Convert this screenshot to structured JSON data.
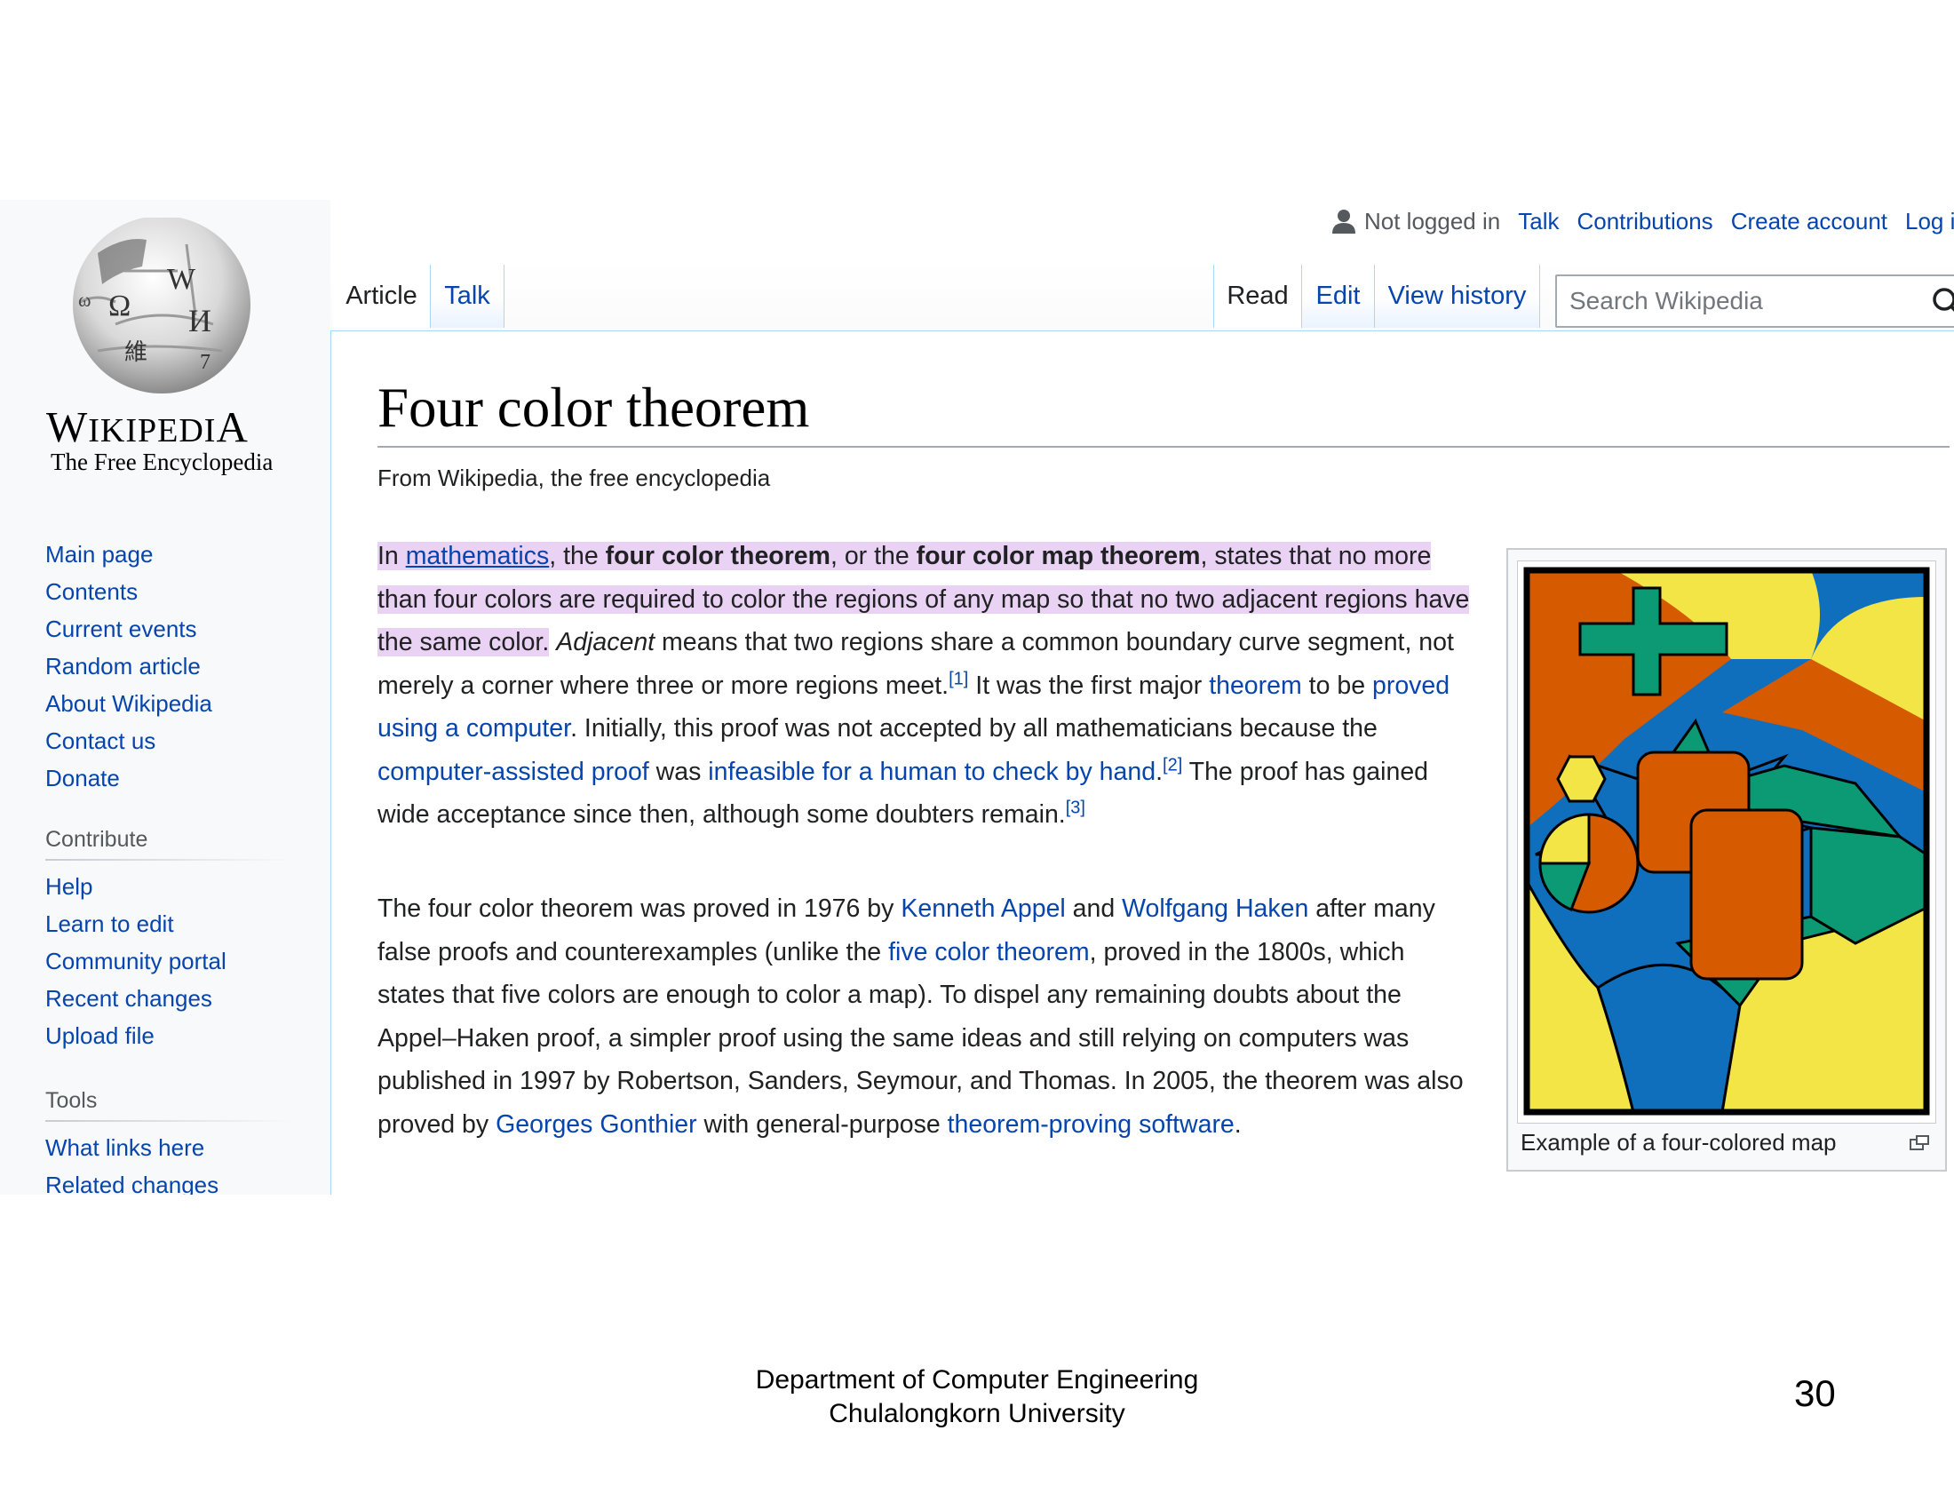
{
  "personal": {
    "not_logged_in": "Not logged in",
    "links": [
      "Talk",
      "Contributions",
      "Create account",
      "Log in"
    ]
  },
  "logo": {
    "wordmark": "Wikipedia",
    "tagline": "The Free Encyclopedia"
  },
  "sidebar": {
    "main": [
      "Main page",
      "Contents",
      "Current events",
      "Random article",
      "About Wikipedia",
      "Contact us",
      "Donate"
    ],
    "contribute_heading": "Contribute",
    "contribute": [
      "Help",
      "Learn to edit",
      "Community portal",
      "Recent changes",
      "Upload file"
    ],
    "tools_heading": "Tools",
    "tools": [
      "What links here",
      "Related changes"
    ]
  },
  "tabs": {
    "article": "Article",
    "talk": "Talk",
    "read": "Read",
    "edit": "Edit",
    "view_history": "View history"
  },
  "search": {
    "placeholder": "Search Wikipedia"
  },
  "article": {
    "title": "Four color theorem",
    "from": "From Wikipedia, the free encyclopedia",
    "p1": {
      "in": "In ",
      "mathematics": "mathematics",
      "comma_the": ", the ",
      "fct": "four color theorem",
      "or_the": ", or the ",
      "fcmt": "four color map theorem",
      "rest_hl": ", states that no more than four colors are required to color the regions of any map so that no two adjacent regions have the same color.",
      "adjacent": "Adjacent",
      "means": " means that two regions share a common boundary curve segment, not merely a corner where three or more regions meet.",
      "ref1": "[1]",
      "it_was": " It was the first major ",
      "theorem": "theorem",
      "to_be": " to be ",
      "proved_computer": "proved using a computer",
      "initially": ". Initially, this proof was not accepted by all mathematicians because the ",
      "cap": "computer-assisted proof",
      "was": " was ",
      "infeasible": "infeasible for a human to check by hand",
      "dot": ".",
      "ref2": "[2]",
      "gained": " The proof has gained wide acceptance since then, although some doubters remain.",
      "ref3": "[3]"
    },
    "p2": {
      "a": "The four color theorem was proved in 1976 by ",
      "appel": "Kenneth Appel",
      "and": " and ",
      "haken": "Wolfgang Haken",
      "b": " after many false proofs and counterexamples (unlike the ",
      "five": "five color theorem",
      "c": ", proved in the 1800s, which states that five colors are enough to color a map). To dispel any remaining doubts about the Appel–Haken proof, a simpler proof using the same ideas and still relying on computers was published in 1997 by Robertson, Sanders, Seymour, and Thomas. In 2005, the theorem was also proved by ",
      "gonthier": "Georges Gonthier",
      "d": " with general-purpose ",
      "tps": "theorem-proving software",
      "e": "."
    },
    "thumb_caption": "Example of a four-colored map"
  },
  "map_colors": {
    "orange": "#d65a00",
    "yellow": "#f2e545",
    "blue": "#0f6fbc",
    "green": "#0b9a73",
    "outline": "#000000"
  },
  "slide_footer": {
    "line1": "Department of Computer Engineering",
    "line2": "Chulalongkorn University",
    "page_number": "30"
  }
}
